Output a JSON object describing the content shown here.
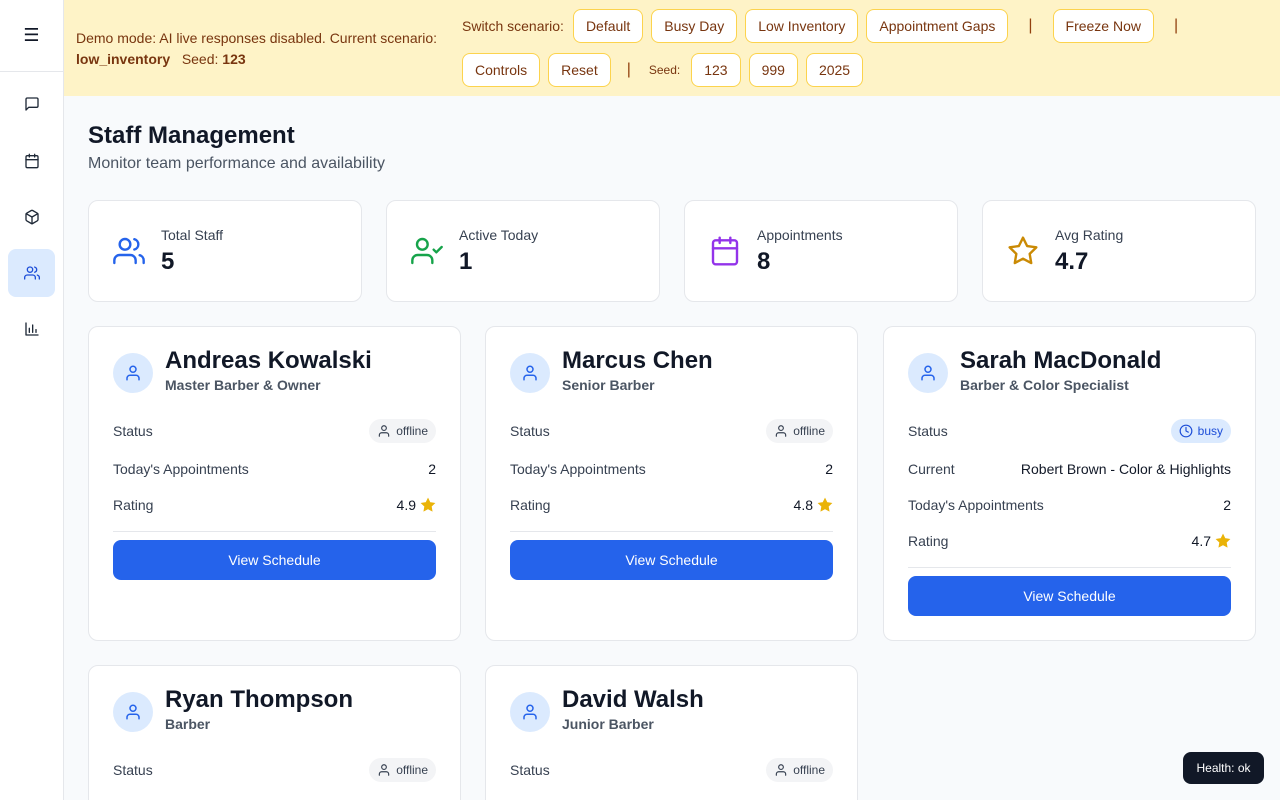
{
  "sidebar": {
    "menu_icon": "☰",
    "items": [
      {
        "icon": "message-icon",
        "label": "Chat"
      },
      {
        "icon": "calendar-icon",
        "label": "Appointments"
      },
      {
        "icon": "package-icon",
        "label": "Inventory"
      },
      {
        "icon": "users-icon",
        "label": "Staff",
        "active": true
      },
      {
        "icon": "bar-chart-icon",
        "label": "Analytics"
      }
    ]
  },
  "banner": {
    "text_prefix": "Demo mode: AI live responses disabled. Current scenario:",
    "scenario": "low_inventory",
    "seed_label": "Seed:",
    "seed_value": "123",
    "switch_label": "Switch scenario:",
    "scenarios": [
      "Default",
      "Busy Day",
      "Low Inventory",
      "Appointment Gaps"
    ],
    "freeze_label": "Freeze Now",
    "controls_label": "Controls",
    "reset_label": "Reset",
    "seed_small_label": "Seed:",
    "seeds": [
      "123",
      "999",
      "2025"
    ],
    "separator": "|"
  },
  "page": {
    "title": "Staff Management",
    "subtitle": "Monitor team performance and availability"
  },
  "stats": [
    {
      "label": "Total Staff",
      "value": "5",
      "icon": "users-icon",
      "color": "#2563eb"
    },
    {
      "label": "Active Today",
      "value": "1",
      "icon": "user-check-icon",
      "color": "#16a34a"
    },
    {
      "label": "Appointments",
      "value": "8",
      "icon": "calendar-icon",
      "color": "#9333ea"
    },
    {
      "label": "Avg Rating",
      "value": "4.7",
      "icon": "star-icon",
      "color": "#ca8a04"
    }
  ],
  "labels": {
    "status": "Status",
    "current": "Current",
    "todays_appointments": "Today's Appointments",
    "rating": "Rating",
    "view_schedule": "View Schedule"
  },
  "staff": [
    {
      "name": "Andreas Kowalski",
      "role": "Master Barber & Owner",
      "status": "offline",
      "appointments": "2",
      "rating": "4.9"
    },
    {
      "name": "Marcus Chen",
      "role": "Senior Barber",
      "status": "offline",
      "appointments": "2",
      "rating": "4.8"
    },
    {
      "name": "Sarah MacDonald",
      "role": "Barber & Color Specialist",
      "status": "busy",
      "current": "Robert Brown - Color & Highlights",
      "appointments": "2",
      "rating": "4.7"
    },
    {
      "name": "Ryan Thompson",
      "role": "Barber",
      "status": "offline"
    },
    {
      "name": "David Walsh",
      "role": "Junior Barber",
      "status": "offline"
    }
  ],
  "health": "Health: ok"
}
